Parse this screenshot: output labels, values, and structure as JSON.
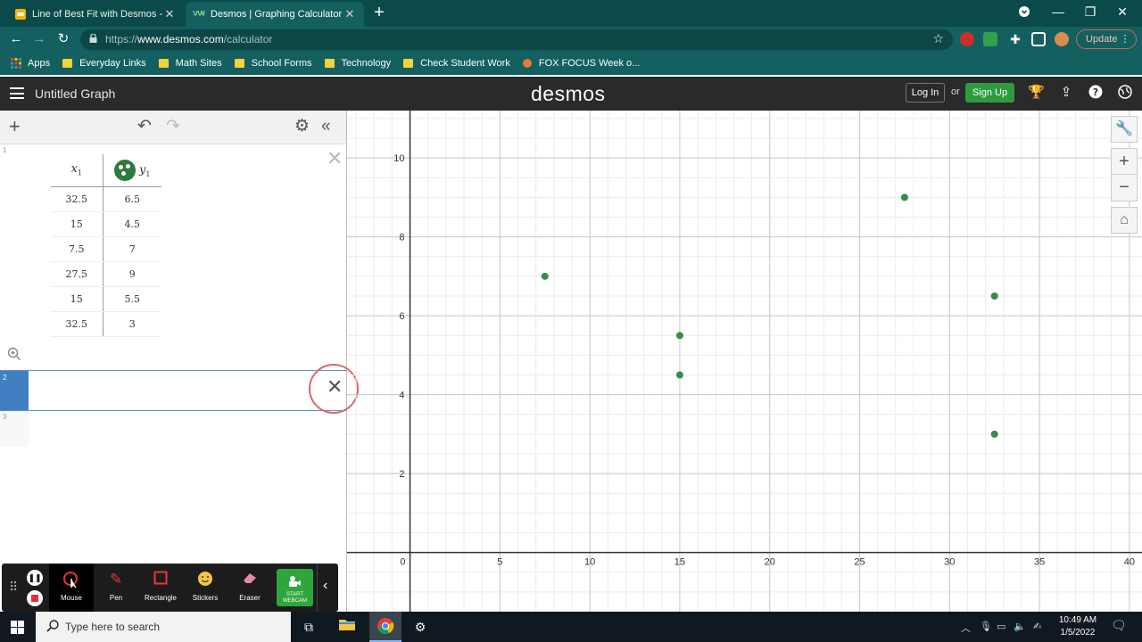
{
  "browser": {
    "tabs": [
      {
        "title": "Line of Best Fit with Desmos - Go",
        "active": false
      },
      {
        "title": "Desmos | Graphing Calculator",
        "active": true
      }
    ],
    "new_tab_glyph": "+",
    "url_prefix": "https://",
    "url_host": "www.desmos.com",
    "url_path": "/calculator",
    "update_label": "Update",
    "bookmarks": [
      {
        "label": "Apps",
        "icon": "apps-grid-icon"
      },
      {
        "label": "Everyday Links",
        "icon": "folder-icon"
      },
      {
        "label": "Math Sites",
        "icon": "folder-icon"
      },
      {
        "label": "School Forms",
        "icon": "folder-icon"
      },
      {
        "label": "Technology",
        "icon": "folder-icon"
      },
      {
        "label": "Check Student Work",
        "icon": "folder-icon"
      },
      {
        "label": "FOX FOCUS Week o...",
        "icon": "fox-icon"
      }
    ]
  },
  "desmos": {
    "graph_title": "Untitled Graph",
    "logo": "desmos",
    "login_label": "Log In",
    "or_label": "or",
    "signup_label": "Sign Up",
    "accent_green": "#2f9b41",
    "point_color": "#388c46"
  },
  "expressions": {
    "rows": [
      {
        "index": "1"
      },
      {
        "index": "2"
      },
      {
        "index": "3"
      }
    ],
    "table": {
      "col_x": "x",
      "col_x_sub": "1",
      "col_y": "y",
      "col_y_sub": "1",
      "rows": [
        {
          "x": "32.5",
          "y": "6.5"
        },
        {
          "x": "15",
          "y": "4.5"
        },
        {
          "x": "7.5",
          "y": "7"
        },
        {
          "x": "27.5",
          "y": "9"
        },
        {
          "x": "15",
          "y": "5.5"
        },
        {
          "x": "32.5",
          "y": "3"
        }
      ]
    }
  },
  "recorder": {
    "buttons": [
      {
        "label": "Mouse",
        "icon": "mouse-pointer-icon"
      },
      {
        "label": "Pen",
        "icon": "pen-icon"
      },
      {
        "label": "Rectangle",
        "icon": "rectangle-icon"
      },
      {
        "label": "Stickers",
        "icon": "sticker-icon"
      },
      {
        "label": "Eraser",
        "icon": "eraser-icon"
      }
    ],
    "webcam_label": "START WEBCAM"
  },
  "chart_data": {
    "type": "scatter",
    "x": [
      32.5,
      15,
      7.5,
      27.5,
      15,
      32.5
    ],
    "y": [
      6.5,
      4.5,
      7,
      9,
      5.5,
      3
    ],
    "xlim": [
      -3.5,
      40.7
    ],
    "ylim": [
      -1.5,
      11.2
    ],
    "x_ticks": [
      0,
      5,
      10,
      15,
      20,
      25,
      30,
      35,
      40
    ],
    "y_ticks": [
      2,
      4,
      6,
      8,
      10
    ],
    "x_tick_labels": [
      "0",
      "5",
      "10",
      "15",
      "20",
      "25",
      "30",
      "35",
      "40"
    ],
    "y_tick_labels": [
      "2",
      "4",
      "6",
      "8",
      "10"
    ],
    "minor_step": 1,
    "grid": true,
    "title": "",
    "xlabel": "",
    "ylabel": ""
  },
  "taskbar": {
    "search_placeholder": "Type here to search",
    "time": "10:49 AM",
    "date": "1/5/2022"
  }
}
